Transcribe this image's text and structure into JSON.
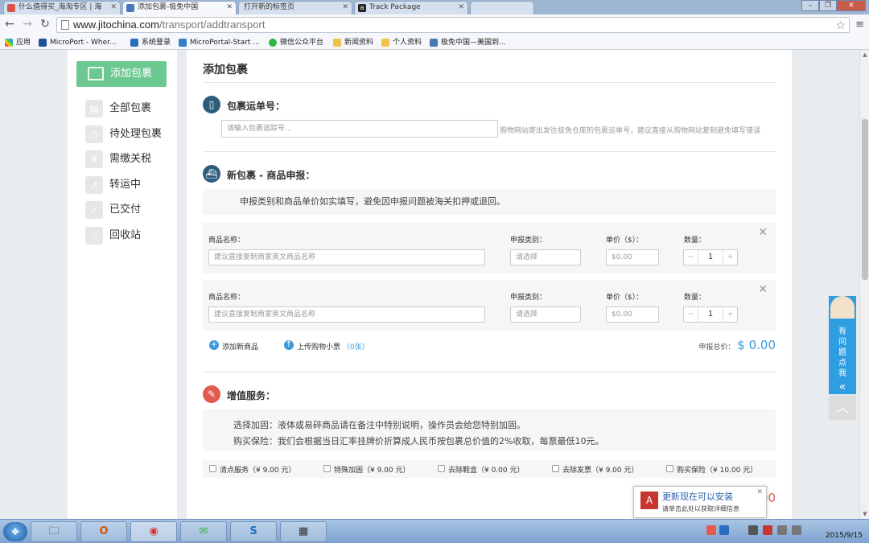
{
  "browser": {
    "tabs": [
      {
        "title": "什么值得买_海淘专区 | 海",
        "active": false
      },
      {
        "title": "添加包裹-极免中国",
        "active": true
      },
      {
        "title": "打开新的标签页",
        "active": false
      },
      {
        "title": "Track Package",
        "active": false
      },
      {
        "title": "",
        "active": false
      }
    ],
    "url_host": "www.jitochina.com",
    "url_path": "/transport/addtransport",
    "bookmarks": [
      "应用",
      "MicroPort - Wher...",
      "系统登录",
      "MicroPortal-Start ...",
      "微信公众平台",
      "新闻资料",
      "个人资料",
      "极免中国—美国到..."
    ]
  },
  "sidebar": {
    "add_button": "添加包裹",
    "items": [
      {
        "label": "全部包裹",
        "icon": "box-icon"
      },
      {
        "label": "待处理包裹",
        "icon": "clock-icon"
      },
      {
        "label": "需缴关税",
        "icon": "yen-icon"
      },
      {
        "label": "转运中",
        "icon": "transit-icon"
      },
      {
        "label": "已交付",
        "icon": "check-icon"
      },
      {
        "label": "回收站",
        "icon": "recycle-icon"
      }
    ]
  },
  "main": {
    "title": "添加包裹",
    "tracking": {
      "section_title": "包裹运单号：",
      "placeholder": "请输入包裹追踪号...",
      "hint": "购物网站寄出发往极免仓库的包裹运单号，建议直接从购物网站复制避免填写错误"
    },
    "declare": {
      "section_title": "新包裹 - 商品申报：",
      "notice": "申报类别和商品单价如实填写，避免因申报问题被海关扣押或退回。",
      "label_name": "商品名称：",
      "label_category": "申报类别：",
      "label_price": "单价（$）：",
      "label_qty": "数量：",
      "name_placeholder": "建议直接复制商家英文商品名称",
      "category_placeholder": "请选择",
      "price_placeholder": "$0.00",
      "items": [
        {
          "qty": "1"
        },
        {
          "qty": "1"
        }
      ],
      "add_item": "添加新商品",
      "upload_receipt": "上传购物小票",
      "receipt_count": "（0张）",
      "total_label": "申报总价：",
      "total_amount": "$ 0.00"
    },
    "services": {
      "section_title": "增值服务：",
      "line1": "选择加固：液体或易碎商品请在备注中特别说明，操作员会给您特别加固。",
      "line2": "购买保险：我们会根据当日汇率挂牌价折算成人民币按包裹总价值的2%收取，每票最低10元。",
      "options": [
        "清点服务（¥ 9.00 元）",
        "特殊加固（¥ 9.00 元）",
        "去除鞋盒（¥ 0.00 元）",
        "去除发票（¥ 9.00 元）",
        "购买保险（¥ 10.00 元）"
      ],
      "total_amount": "¥ 0.00"
    }
  },
  "help_widget": {
    "text": "有问题点我",
    "arrow": "«",
    "to_top": "︿"
  },
  "update_popup": {
    "title": "更新现在可以安装",
    "subtitle": "请单击此处以获取详细信息"
  },
  "taskbar": {
    "time": "",
    "date": "2015/9/15"
  }
}
